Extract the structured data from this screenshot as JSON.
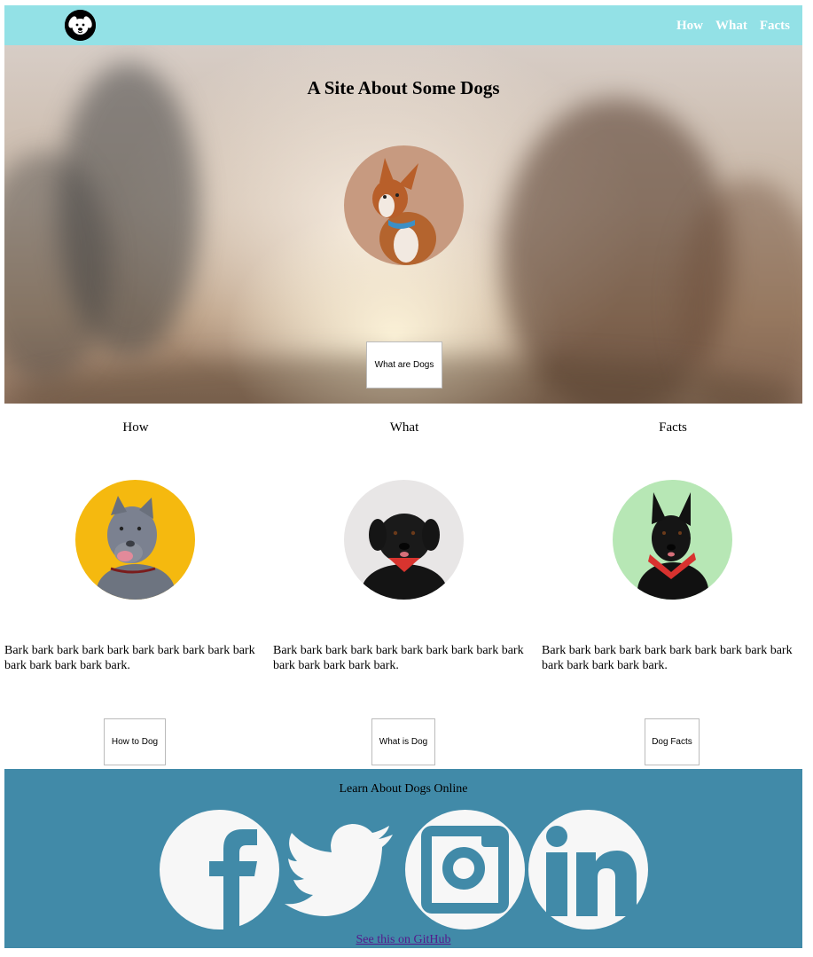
{
  "nav": {
    "logo_icon": "dog-face-logo",
    "links": [
      "How",
      "What",
      "Facts"
    ]
  },
  "hero": {
    "title": "A Site About Some Dogs",
    "button_label": "What are Dogs",
    "avatar": "brown-white-dog-photo"
  },
  "columns": [
    {
      "title": "How",
      "avatar": "grey-pitbull-photo",
      "avatar_bg": "#f5b90f",
      "text": "Bark bark bark bark bark bark bark bark bark bark bark bark bark bark bark.",
      "button_label": "How to Dog"
    },
    {
      "title": "What",
      "avatar": "black-dog-red-bandana-photo",
      "avatar_bg": "#e8e6e6",
      "text": "Bark bark bark bark bark bark bark bark bark bark bark bark bark bark bark.",
      "button_label": "What is Dog"
    },
    {
      "title": "Facts",
      "avatar": "black-shepherd-red-bandana-photo",
      "avatar_bg": "#b7e7b5",
      "text": "Bark bark bark bark bark bark bark bark bark bark bark bark bark bark bark.",
      "button_label": "Dog Facts"
    }
  ],
  "footer": {
    "title": "Learn About Dogs Online",
    "social_icons": [
      "facebook-icon",
      "twitter-icon",
      "instagram-icon",
      "linkedin-icon"
    ],
    "github_link": "See this on GitHub"
  },
  "colors": {
    "nav_bg": "#93e1e6",
    "footer_bg": "#418aa8",
    "icon_fill": "#f7f7f7",
    "link": "#551a8b"
  }
}
